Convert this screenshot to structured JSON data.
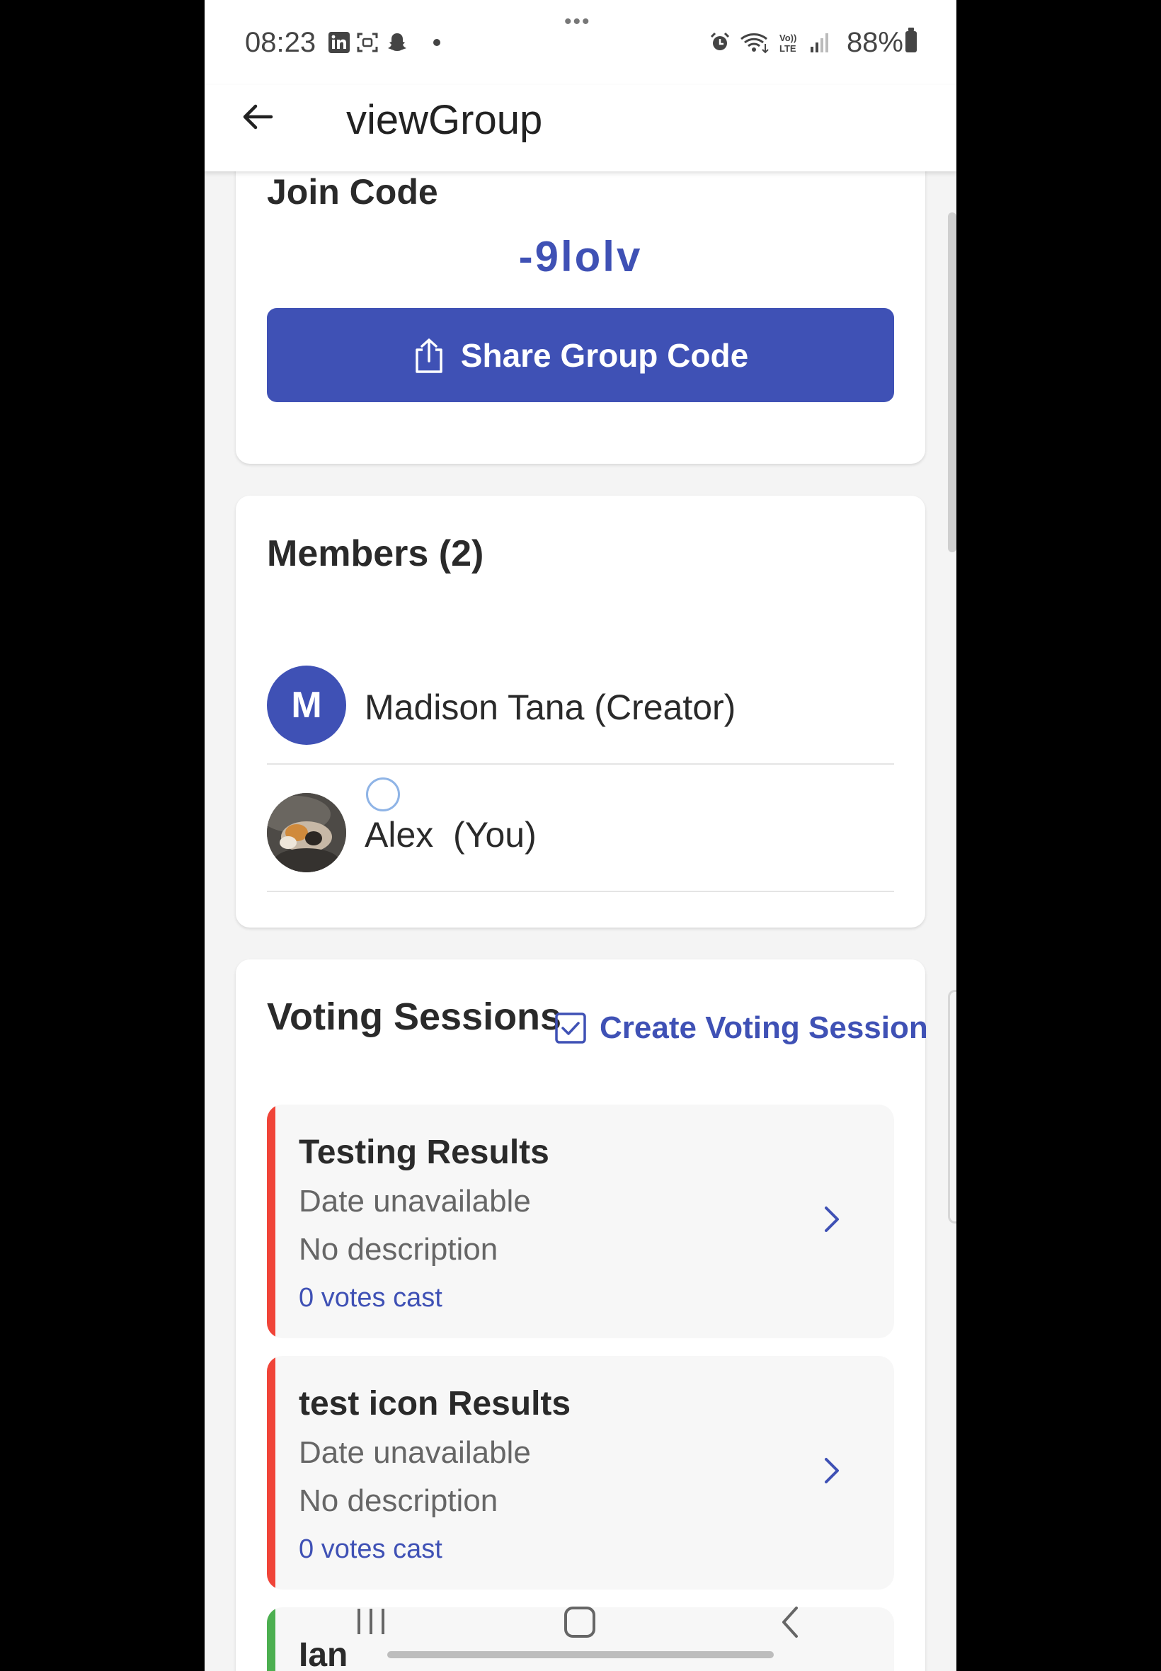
{
  "status_bar": {
    "time": "08:23",
    "battery": "88%",
    "icons": [
      "linkedin-icon",
      "screen-record-icon",
      "snapchat-icon",
      "dot-icon",
      "alarm-icon",
      "wifi-icon",
      "volte-icon",
      "signal-icon",
      "battery-icon"
    ]
  },
  "app_bar": {
    "title": "viewGroup"
  },
  "join": {
    "title": "Join Code",
    "code": "-9lolv",
    "share_label": "Share Group Code"
  },
  "members": {
    "title": "Members (2)",
    "items": [
      {
        "initial": "M",
        "name": "Madison Tana (Creator)"
      },
      {
        "name": "Alex  (You)"
      }
    ]
  },
  "voting": {
    "title": "Voting Sessions",
    "create_label": "Create Voting Session",
    "sessions": [
      {
        "title": "Testing Results",
        "date": "Date unavailable",
        "description": "No description",
        "votes": "0 votes cast",
        "status_color": "#f04438"
      },
      {
        "title": "test icon Results",
        "date": "Date unavailable",
        "description": "No description",
        "votes": "0 votes cast",
        "status_color": "#f04438"
      },
      {
        "title": "Ian",
        "status_color": "#4caf50"
      }
    ]
  },
  "colors": {
    "accent": "#3f51b5",
    "closed": "#f04438",
    "open": "#4caf50"
  }
}
